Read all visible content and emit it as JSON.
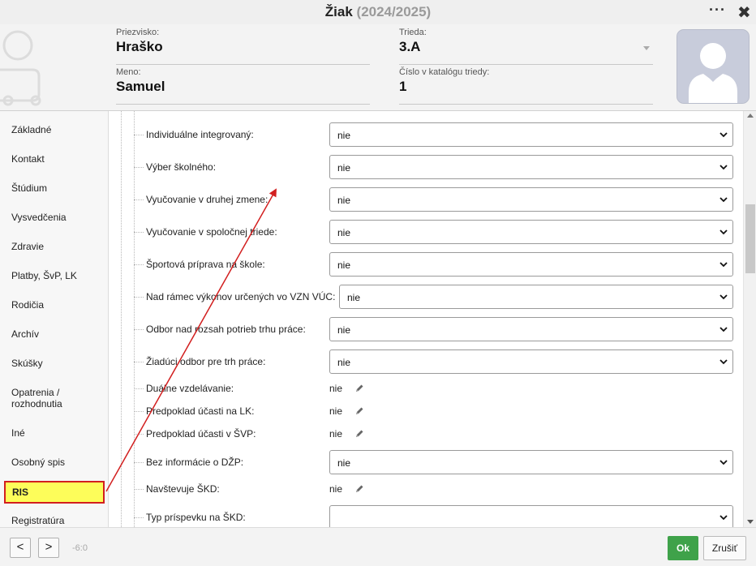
{
  "window": {
    "title": "Žiak",
    "year": "(2024/2025)"
  },
  "header": {
    "surname_label": "Priezvisko:",
    "surname": "Hraško",
    "name_label": "Meno:",
    "name": "Samuel",
    "class_label": "Trieda:",
    "class": "3.A",
    "catalog_label": "Číslo v katalógu triedy:",
    "catalog": "1"
  },
  "sidebar": {
    "items": [
      {
        "label": "Základné"
      },
      {
        "label": "Kontakt"
      },
      {
        "label": "Štúdium"
      },
      {
        "label": "Vysvedčenia"
      },
      {
        "label": "Zdravie"
      },
      {
        "label": "Platby, ŠvP, LK"
      },
      {
        "label": "Rodičia"
      },
      {
        "label": "Archív"
      },
      {
        "label": "Skúšky"
      },
      {
        "label": "Opatrenia /"
      },
      {
        "label": "rozhodnutia"
      },
      {
        "label": "Iné"
      },
      {
        "label": "Osobný spis"
      },
      {
        "label": "RIS"
      },
      {
        "label": "Registratúra"
      }
    ]
  },
  "form": {
    "rows": [
      {
        "label": "Individuálne integrovaný:",
        "value": "nie"
      },
      {
        "label": "Výber školného:",
        "value": "nie"
      },
      {
        "label": "Vyučovanie v druhej zmene:",
        "value": "nie"
      },
      {
        "label": "Vyučovanie v spoločnej triede:",
        "value": "nie"
      },
      {
        "label": "Športová príprava na škole:",
        "value": "nie"
      },
      {
        "label": "Nad rámec výkonov určených vo VZN VÚC:",
        "value": "nie"
      },
      {
        "label": "Odbor nad rozsah potrieb trhu práce:",
        "value": "nie"
      },
      {
        "label": "Žiadúci odbor pre trh práce:",
        "value": "nie"
      },
      {
        "label": "Duálne vzdelávanie:",
        "value": "nie"
      },
      {
        "label": "Predpoklad účasti na LK:",
        "value": "nie"
      },
      {
        "label": "Predpoklad účasti v ŠVP:",
        "value": "nie"
      },
      {
        "label": "Bez informácie o DŽP:",
        "value": "nie"
      },
      {
        "label": "Navštevuje ŠKD:",
        "value": "nie"
      },
      {
        "label": "Typ príspevku na ŠKD:",
        "value": ""
      }
    ]
  },
  "footer": {
    "prev": "<",
    "next": ">",
    "record": "-6:0",
    "ok": "Ok",
    "cancel": "Zrušiť"
  },
  "colors": {
    "ok_green": "#3fa24a",
    "highlight_yellow": "#fdfd5a",
    "annotation_red": "#d21f1f"
  }
}
